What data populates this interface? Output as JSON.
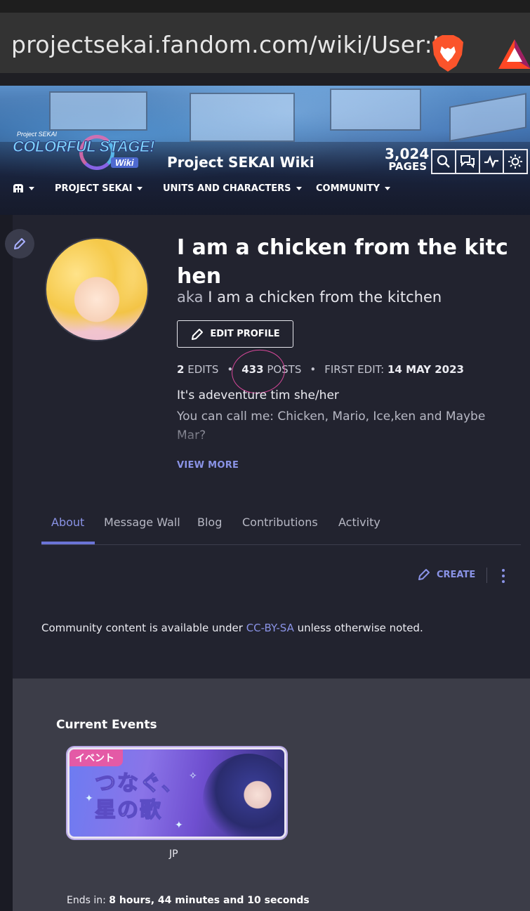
{
  "browser": {
    "url": "projectsekai.fandom.com/wiki/User:I_"
  },
  "header": {
    "logo_small": "Project SEKAI",
    "logo_main": "COLORFUL STAGE!",
    "logo_wiki": "Wiki",
    "site_name": "Project SEKAI Wiki",
    "pages_count": "3,024",
    "pages_label": "PAGES"
  },
  "nav": {
    "items": [
      {
        "label": "PROJECT SEKAI"
      },
      {
        "label": "UNITS AND CHARACTERS"
      },
      {
        "label": "COMMUNITY"
      }
    ]
  },
  "profile": {
    "username": "I am a chicken from the kitchen",
    "aka_prefix": "aka",
    "aka_name": "I am a chicken from the kitchen",
    "edit_profile_label": "EDIT PROFILE",
    "edits_count": "2",
    "edits_label": "EDITS",
    "posts_count": "433",
    "posts_label": "POSTS",
    "first_edit_label": "FIRST EDIT:",
    "first_edit_date": "14 MAY 2023",
    "bio_line1": "It's adeventure tim she/her",
    "bio_line2": "You can call me: Chicken, Mario, Ice,ken and Maybe Mar?",
    "view_more": "VIEW MORE"
  },
  "tabs": [
    {
      "label": "About",
      "active": true
    },
    {
      "label": "Message Wall",
      "active": false
    },
    {
      "label": "Blog",
      "active": false
    },
    {
      "label": "Contributions",
      "active": false
    },
    {
      "label": "Activity",
      "active": false
    }
  ],
  "actions": {
    "create_label": "CREATE"
  },
  "license": {
    "prefix": "Community content is available under ",
    "link": "CC-BY-SA",
    "suffix": " unless otherwise noted."
  },
  "events": {
    "title": "Current Events",
    "banner_tag": "イベント",
    "banner_title_line1": "つなぐ、",
    "banner_title_line2": "星の歌",
    "region": "JP",
    "ends_in_label": "Ends in:",
    "ends_in_value": "8 hours, 44 minutes and 10 seconds"
  },
  "colors": {
    "accent": "#8a93e6",
    "background": "#22232f",
    "events_bg": "#3c3d48",
    "annotation_circle": "#d7489a"
  }
}
